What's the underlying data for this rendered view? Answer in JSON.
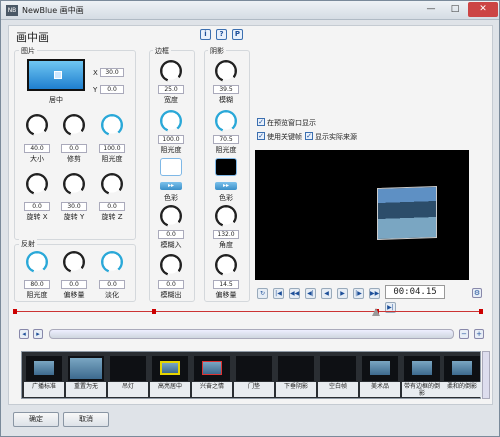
{
  "window": {
    "title": "NewBlue 画中画",
    "app_icon": "NB",
    "min": "—",
    "max": "□",
    "close": "✕"
  },
  "heading": "画中画",
  "help_buttons": [
    "i",
    "?",
    "P"
  ],
  "picture": {
    "label": "图片",
    "x_label": "X",
    "x_value": "30.0",
    "y_label": "Y",
    "y_value": "0.0",
    "center_label": "居中",
    "knobs": [
      {
        "label": "大小",
        "value": "40.0"
      },
      {
        "label": "修剪",
        "value": "0.0"
      },
      {
        "label": "阻光度",
        "value": "100.0"
      },
      {
        "label": "旋转 X",
        "value": "0.0"
      },
      {
        "label": "旋转 Y",
        "value": "30.0"
      },
      {
        "label": "旋转 Z",
        "value": "0.0"
      }
    ]
  },
  "reflection": {
    "label": "反射",
    "knobs": [
      {
        "label": "阻光度",
        "value": "80.0"
      },
      {
        "label": "偏移量",
        "value": "0.0"
      },
      {
        "label": "淡化",
        "value": "0.0"
      }
    ]
  },
  "border": {
    "label": "边框",
    "knobs": [
      {
        "label": "宽度",
        "value": "25.0"
      },
      {
        "label": "阻光度",
        "value": "100.0"
      },
      {
        "label": "模糊入",
        "value": "0.0"
      },
      {
        "label": "模糊出",
        "value": "0.0"
      }
    ],
    "color_label": "色彩",
    "color": "#ffffff"
  },
  "shadow": {
    "label": "阴影",
    "knobs": [
      {
        "label": "模糊",
        "value": "39.5"
      },
      {
        "label": "阻光度",
        "value": "70.5"
      },
      {
        "label": "角度",
        "value": "132.0"
      },
      {
        "label": "偏移量",
        "value": "14.5"
      }
    ],
    "color_label": "色彩",
    "color": "#000000"
  },
  "options": [
    {
      "label": "在预览窗口显示"
    },
    {
      "label": "使用关键帧"
    },
    {
      "label": "显示实际来源"
    }
  ],
  "transport": {
    "timecode": "00:04.15",
    "buttons": [
      "↻",
      "|◀",
      "◀◀",
      "◀|",
      "◀",
      "▶",
      "|▶",
      "▶▶",
      "▶|"
    ]
  },
  "presets": [
    "广播标准",
    "重置为无",
    "吊灯",
    "高亮居中",
    "兴奋之情",
    "门垫",
    "下垂阴影",
    "空白帧",
    "美术品",
    "带有边框的倒影",
    "柔和的倒影"
  ],
  "footer": {
    "ok": "确定",
    "cancel": "取消"
  },
  "accent": "#2aa8d8"
}
